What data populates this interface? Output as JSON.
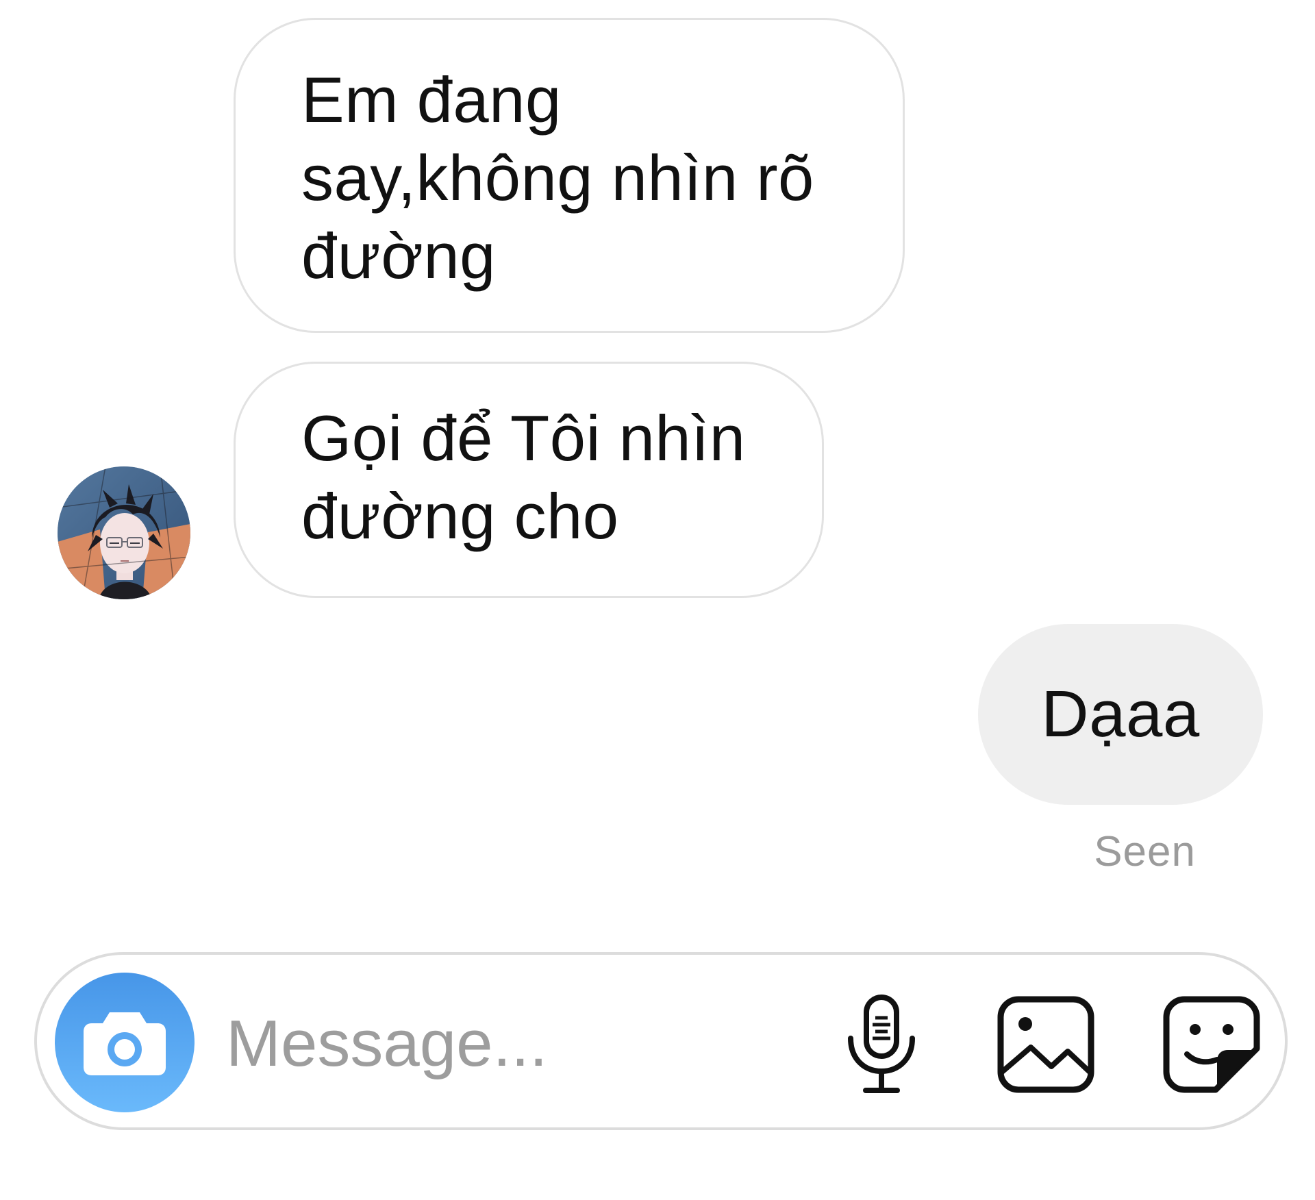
{
  "conversation": {
    "messages": [
      {
        "direction": "incoming",
        "lines": [
          "Em đang",
          "say,không nhìn rõ",
          "đường"
        ]
      },
      {
        "direction": "incoming",
        "lines": [
          "Gọi để Tôi nhìn",
          "đường cho"
        ]
      },
      {
        "direction": "outgoing",
        "text": "Dạaa"
      }
    ],
    "seen_label": "Seen"
  },
  "composer": {
    "placeholder": "Message...",
    "value": "",
    "icons": {
      "camera": "camera-icon",
      "microphone": "microphone-icon",
      "gallery": "gallery-icon",
      "sticker": "sticker-icon"
    }
  },
  "colors": {
    "camera_button_top": "#4796e8",
    "camera_button_bottom": "#6ab9fb",
    "incoming_bubble_border": "#e2e2e2",
    "outgoing_bubble_fill": "#efefef",
    "seen_text": "#9b9b9b",
    "placeholder_text": "#9d9d9d"
  }
}
